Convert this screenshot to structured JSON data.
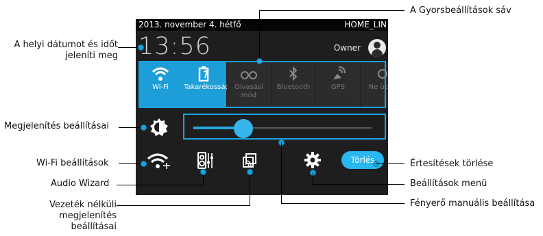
{
  "status_bar": {
    "date": "2013. november 4. hétfő",
    "carrier": "HOME_LIN"
  },
  "clock": {
    "time": "13:56"
  },
  "user": {
    "name": "Owner"
  },
  "quick_settings": [
    {
      "label": "Wi-Fi",
      "icon": "wifi-icon",
      "active": true
    },
    {
      "label": "Takarékosság",
      "icon": "power-saver-icon",
      "active": true
    },
    {
      "label": "Olvasási mód",
      "icon": "glasses-icon",
      "active": false
    },
    {
      "label": "Bluetooth",
      "icon": "bluetooth-icon",
      "active": false
    },
    {
      "label": "GPS",
      "icon": "gps-icon",
      "active": false
    },
    {
      "label": "Ne üzen",
      "icon": "notification-icon",
      "active": false
    }
  ],
  "brightness": {
    "icon": "brightness-icon",
    "level": 0.28
  },
  "settings_row": {
    "wifi_icon": "wifi-settings-icon",
    "audio_icon": "audio-wizard-icon",
    "display_icon": "wireless-display-icon",
    "gear_icon": "gear-icon",
    "clear_label": "Törlés"
  },
  "callouts": {
    "quick_settings_bar": "A Gyorsbeállítások sáv",
    "date_time": "A helyi dátumot és időt jeleníti meg",
    "display_settings": "Megjelenítés beállításai",
    "wifi_settings": "Wi-Fi beállítások",
    "audio_wizard": "Audio Wizard",
    "wireless_display": "Vezeték nélküli megjelenítés beállításai",
    "clear_notifications": "Értesítések törlése",
    "settings_menu": "Beállítások menü",
    "brightness_manual": "Fényerő manuális beállítása"
  },
  "colors": {
    "accent": "#1aa3e0",
    "panel": "#1e1e1e",
    "active_tile": "#1d9ed8"
  }
}
